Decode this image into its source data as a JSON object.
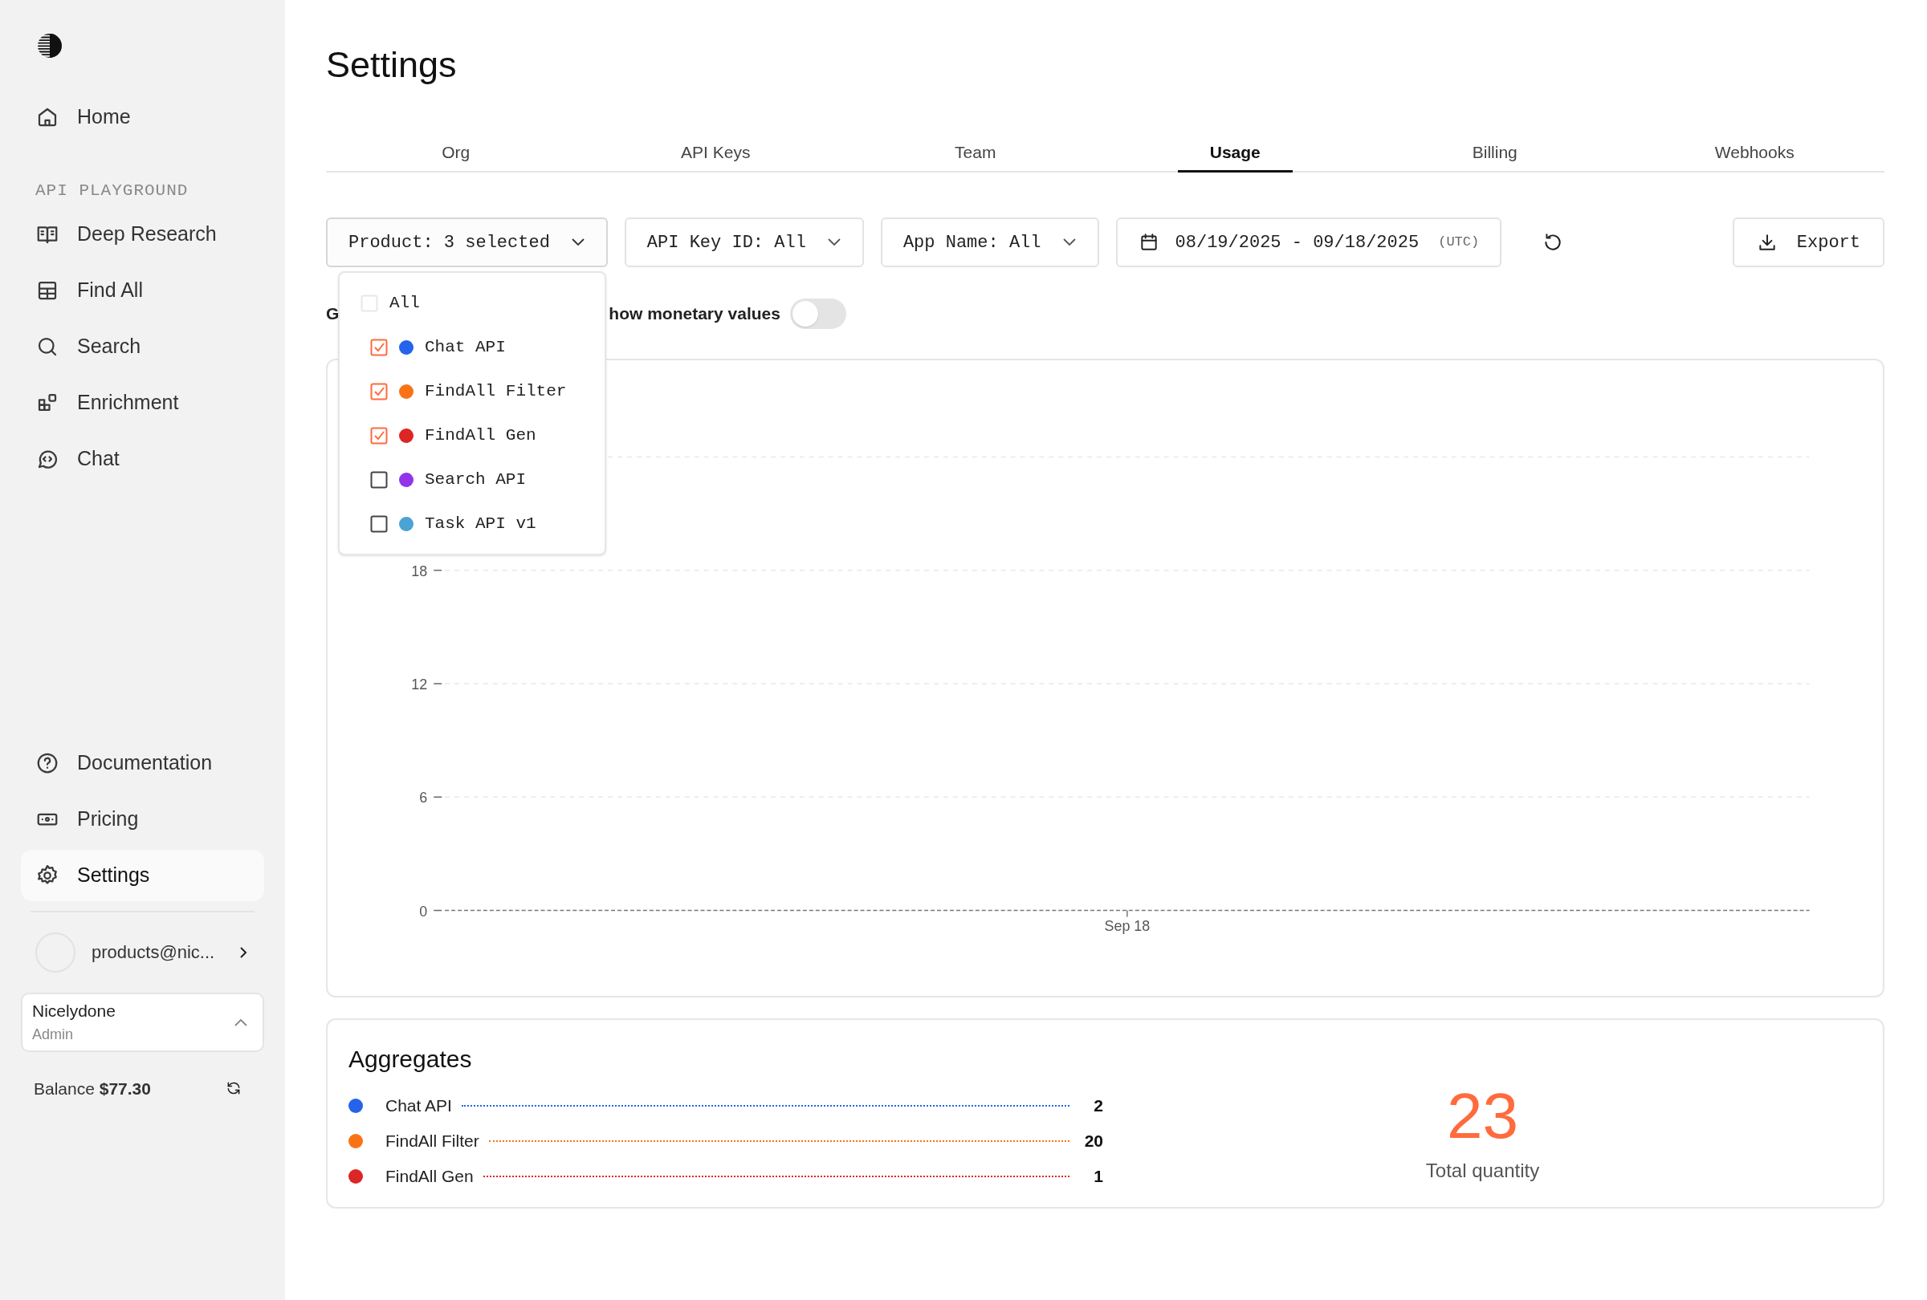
{
  "sidebar": {
    "top_items": [
      {
        "label": "Home",
        "kind": "home",
        "selected": false
      }
    ],
    "section_label": "API PLAYGROUND",
    "playground_items": [
      {
        "label": "Deep Research",
        "kind": "book",
        "selected": false
      },
      {
        "label": "Find All",
        "kind": "table",
        "selected": false
      },
      {
        "label": "Search",
        "kind": "search",
        "selected": false
      },
      {
        "label": "Enrichment",
        "kind": "blocks",
        "selected": false
      },
      {
        "label": "Chat",
        "kind": "chat",
        "selected": false
      }
    ],
    "bottom_items": [
      {
        "label": "Documentation",
        "kind": "help",
        "selected": false
      },
      {
        "label": "Pricing",
        "kind": "money",
        "selected": false
      },
      {
        "label": "Settings",
        "kind": "gear",
        "selected": true
      }
    ],
    "user": {
      "email": "products@nic..."
    },
    "org": {
      "name": "Nicelydone",
      "role": "Admin"
    },
    "balance": {
      "label": "Balance",
      "amount": "$77.30"
    }
  },
  "page_title": "Settings",
  "tabs": [
    {
      "label": "Org",
      "selected": false
    },
    {
      "label": "API Keys",
      "selected": false
    },
    {
      "label": "Team",
      "selected": false
    },
    {
      "label": "Usage",
      "selected": true
    },
    {
      "label": "Billing",
      "selected": false
    },
    {
      "label": "Webhooks",
      "selected": false
    }
  ],
  "filters": [
    {
      "label": "Product: 3 selected",
      "expanded": true
    },
    {
      "label": "API Key ID: All",
      "expanded": false
    },
    {
      "label": "App Name: All",
      "expanded": false
    }
  ],
  "date_range": {
    "value": "08/19/2025 - 09/18/2025",
    "zone": "(UTC)"
  },
  "export_button": "Export",
  "product_menu": [
    {
      "label": "All",
      "kind": "all",
      "checked": false
    },
    {
      "label": "Chat API",
      "kind": "product",
      "checked": true,
      "color": "#2563eb"
    },
    {
      "label": "FindAll Filter",
      "kind": "product",
      "checked": true,
      "color": "#f97316"
    },
    {
      "label": "FindAll Gen",
      "kind": "product",
      "checked": true,
      "color": "#dc2626"
    },
    {
      "label": "Search API",
      "kind": "product",
      "checked": false,
      "color": "#9333ea"
    },
    {
      "label": "Task API v1",
      "kind": "product",
      "checked": false,
      "color": "#4ba3d3"
    }
  ],
  "options_row": {
    "group_label": "G",
    "toggle_label": "how monetary values",
    "toggle_on": false
  },
  "usage_chart": {
    "chart_data": {
      "type": "bar",
      "categories": [
        "Sep 18"
      ],
      "grid": true,
      "ylim": [
        0,
        24
      ],
      "yticks": [
        0,
        6,
        12,
        18
      ]
    }
  },
  "aggregates": {
    "title": "Aggregates",
    "rows": [
      {
        "name": "Chat API",
        "color": "#2563eb",
        "value": "2"
      },
      {
        "name": "FindAll Filter",
        "color": "#f97316",
        "value": "20"
      },
      {
        "name": "FindAll Gen",
        "color": "#dc2626",
        "value": "1"
      }
    ],
    "total": "23",
    "total_label": "Total quantity"
  }
}
